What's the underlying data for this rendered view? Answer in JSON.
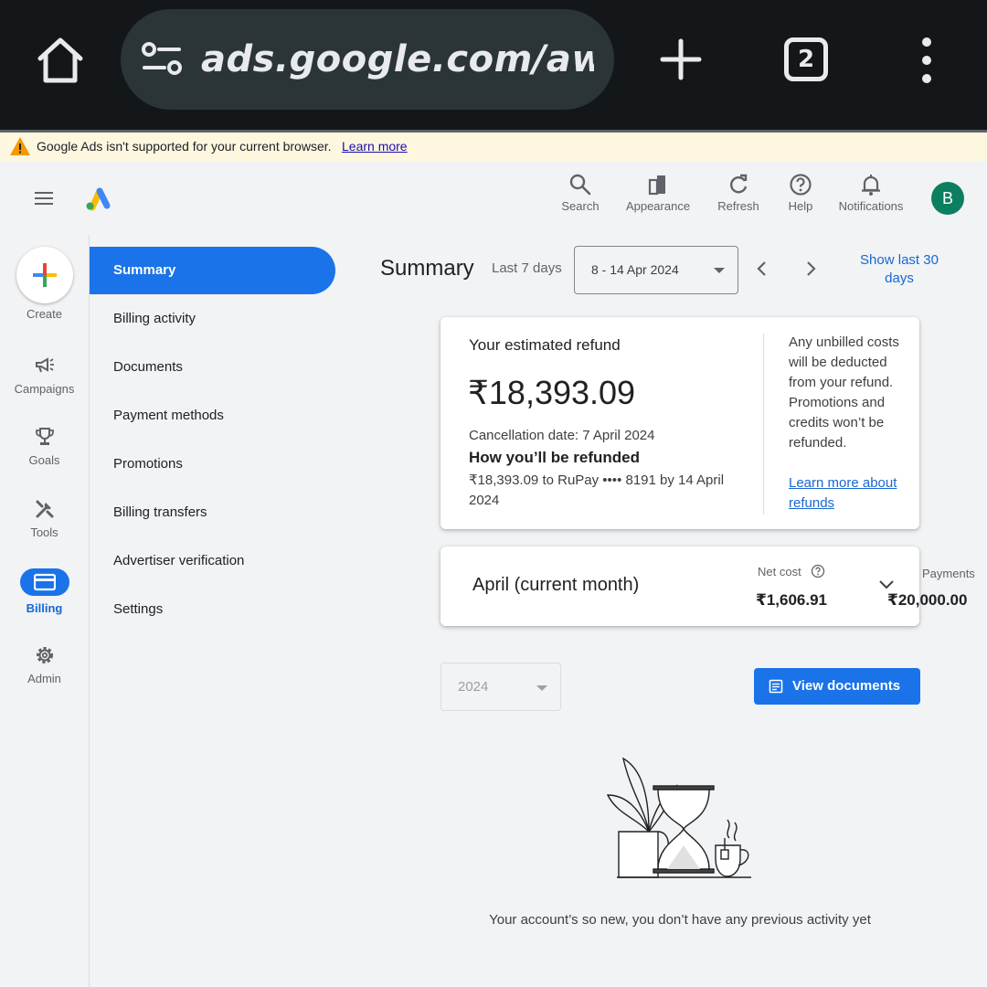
{
  "browser": {
    "url": "ads.google.com/aw/b",
    "tab_count": "2",
    "icons": [
      "home-icon",
      "site-settings-icon",
      "new-tab-icon",
      "more-vert-icon"
    ]
  },
  "banner": {
    "message": "Google Ads isn't supported for your current browser.",
    "link": "Learn more"
  },
  "header": {
    "buttons": {
      "search": "Search",
      "appearance": "Appearance",
      "refresh": "Refresh",
      "help": "Help",
      "notifications": "Notifications"
    },
    "avatar_initial": "B",
    "avatar_color": "#0b7f5f"
  },
  "rail": {
    "create": "Create",
    "campaigns": "Campaigns",
    "goals": "Goals",
    "tools": "Tools",
    "billing": "Billing",
    "admin": "Admin"
  },
  "nav": {
    "items": [
      "Summary",
      "Billing activity",
      "Documents",
      "Payment methods",
      "Promotions",
      "Billing transfers",
      "Advertiser verification",
      "Settings"
    ],
    "active": "Summary"
  },
  "summary": {
    "title": "Summary",
    "range_label": "Last 7 days",
    "date_range": "8 - 14 Apr 2024",
    "show_last": "Show last 30 days"
  },
  "refund": {
    "title": "Your estimated refund",
    "amount": "₹18,393.09",
    "cancellation": "Cancellation date: 7 April 2024",
    "how_title": "How you’ll be refunded",
    "how_detail": "₹18,393.09 to RuPay •••• 8191 by 14 April 2024",
    "note": "Any unbilled costs will be deducted from your refund. Promotions and credits won’t be refunded.",
    "note_link": "Learn more about refunds"
  },
  "month": {
    "label": "April (current month)",
    "net_cost_label": "Net cost",
    "net_cost": "₹1,606.91",
    "payments_label": "Payments",
    "payments": "₹20,000.00"
  },
  "documents": {
    "year": "2024",
    "view_button": "View documents"
  },
  "empty_state": {
    "message": "Your account’s so new, you don’t have any previous activity yet"
  },
  "colors": {
    "accent": "#1a73e8",
    "link": "#1967d2",
    "banner_bg": "#fef7e0",
    "warning": "#f29900"
  }
}
